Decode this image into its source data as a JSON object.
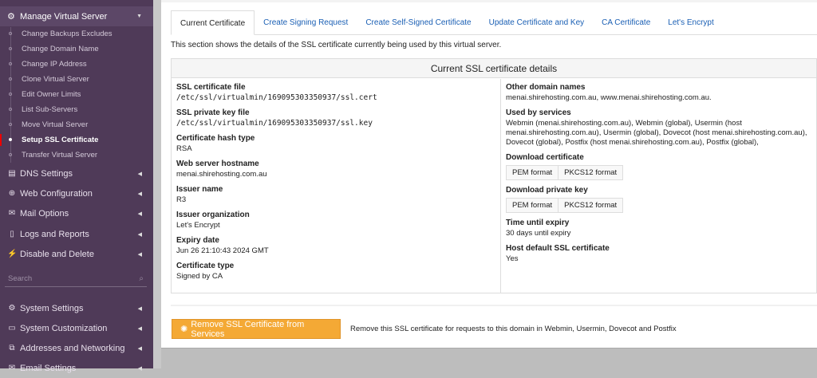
{
  "sidebar": {
    "section": {
      "label": "Manage Virtual Server",
      "icon": "cogs-icon"
    },
    "sub_items": [
      "Change Backups Excludes",
      "Change Domain Name",
      "Change IP Address",
      "Clone Virtual Server",
      "Edit Owner Limits",
      "List Sub-Servers",
      "Move Virtual Server",
      "Setup SSL Certificate",
      "Transfer Virtual Server"
    ],
    "active_sub": "Setup SSL Certificate",
    "groups": [
      {
        "label": "DNS Settings",
        "icon": "server-icon"
      },
      {
        "label": "Web Configuration",
        "icon": "globe-icon"
      },
      {
        "label": "Mail Options",
        "icon": "envelope-open-icon"
      },
      {
        "label": "Logs and Reports",
        "icon": "file-icon"
      },
      {
        "label": "Disable and Delete",
        "icon": "plug-icon"
      }
    ],
    "search_placeholder": "Search",
    "system": [
      {
        "label": "System Settings",
        "icon": "gear-icon"
      },
      {
        "label": "System Customization",
        "icon": "laptop-icon"
      },
      {
        "label": "Addresses and Networking",
        "icon": "network-icon"
      },
      {
        "label": "Email Settings",
        "icon": "envelope-icon"
      }
    ]
  },
  "tabs": [
    "Current Certificate",
    "Create Signing Request",
    "Create Self-Signed Certificate",
    "Update Certificate and Key",
    "CA Certificate",
    "Let's Encrypt"
  ],
  "description": "This section shows the details of the SSL certificate currently being used by this virtual server.",
  "details": {
    "title": "Current SSL certificate details",
    "left": [
      {
        "label": "SSL certificate file",
        "value": "/etc/ssl/virtualmin/169095303350937/ssl.cert",
        "mono": true
      },
      {
        "label": "SSL private key file",
        "value": "/etc/ssl/virtualmin/169095303350937/ssl.key",
        "mono": true
      },
      {
        "label": "Certificate hash type",
        "value": "RSA"
      },
      {
        "label": "Web server hostname",
        "value": "menai.shirehosting.com.au"
      },
      {
        "label": "Issuer name",
        "value": "R3"
      },
      {
        "label": "Issuer organization",
        "value": "Let's Encrypt"
      },
      {
        "label": "Expiry date",
        "value": "Jun 26 21:10:43 2024 GMT"
      },
      {
        "label": "Certificate type",
        "value": "Signed by CA"
      }
    ],
    "other_domains": {
      "label": "Other domain names",
      "value": "menai.shirehosting.com.au, www.menai.shirehosting.com.au."
    },
    "used_by": {
      "label": "Used by services",
      "value": "Webmin (menai.shirehosting.com.au), Webmin (global), Usermin (host menai.shirehosting.com.au), Usermin (global), Dovecot (host menai.shirehosting.com.au), Dovecot (global), Postfix (host menai.shirehosting.com.au), Postfix (global),"
    },
    "download_cert": {
      "label": "Download certificate",
      "pem": "PEM format",
      "pkcs12": "PKCS12 format"
    },
    "download_key": {
      "label": "Download private key",
      "pem": "PEM format",
      "pkcs12": "PKCS12 format"
    },
    "expiry": {
      "label": "Time until expiry",
      "value": "30 days until expiry"
    },
    "host_default": {
      "label": "Host default SSL certificate",
      "value": "Yes"
    }
  },
  "remove": {
    "label": "Remove SSL Certificate from Services",
    "description": "Remove this SSL certificate for requests to this domain in Webmin, Usermin, Dovecot and Postfix",
    "color": "#f4a935"
  }
}
